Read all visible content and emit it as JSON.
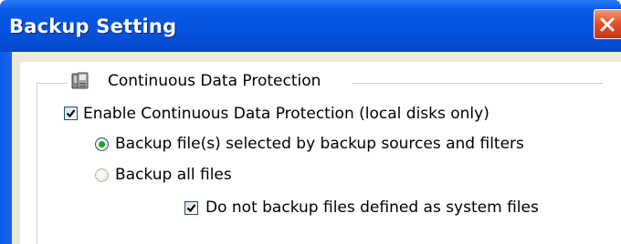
{
  "window": {
    "title": "Backup Setting"
  },
  "group": {
    "label": "Continuous Data Protection",
    "icon": "cdp-computer-icon"
  },
  "options": {
    "enable_cdp": {
      "label": "Enable Continuous Data Protection (local disks only)",
      "checked": true
    },
    "radio_selected_sources": {
      "label": "Backup file(s) selected by backup sources and filters",
      "selected": true
    },
    "radio_all_files": {
      "label": "Backup all files",
      "selected": false
    },
    "exclude_system_files": {
      "label": "Do not backup files defined as system files",
      "checked": true
    }
  },
  "colors": {
    "titlebar": "#0353dc",
    "close_button": "#e0542c",
    "radio_dot": "#21a121",
    "client_bg": "#ece9d8"
  }
}
